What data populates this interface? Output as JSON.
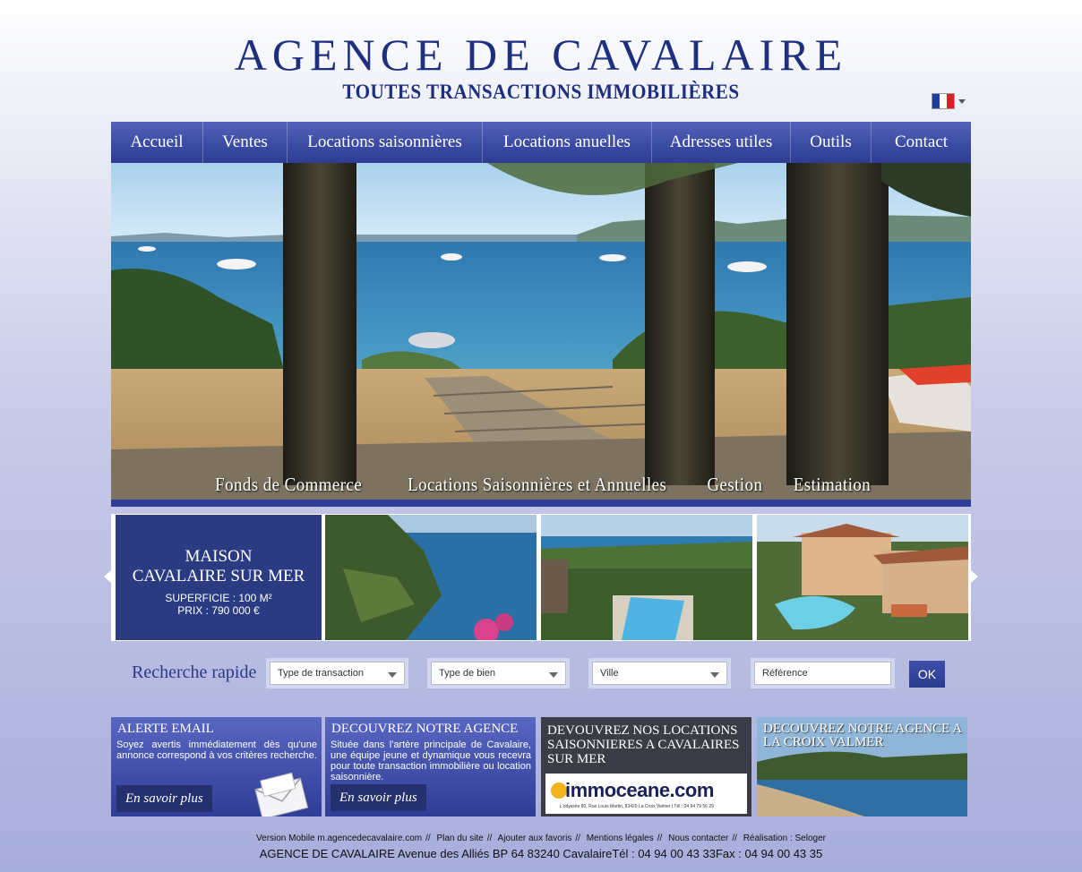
{
  "header": {
    "title": "AGENCE DE CAVALAIRE",
    "subtitle": "TOUTES TRANSACTIONS IMMOBILIÈRES",
    "language": "fr"
  },
  "nav": {
    "items": [
      {
        "label": "Accueil"
      },
      {
        "label": "Ventes"
      },
      {
        "label": "Locations saisonnières"
      },
      {
        "label": "Locations anuelles"
      },
      {
        "label": "Adresses utiles"
      },
      {
        "label": "Outils"
      },
      {
        "label": "Contact"
      }
    ]
  },
  "hero": {
    "captions": [
      "Fonds de Commerce",
      "Locations Saisonnières et Annuelles",
      "Gestion",
      "Estimation"
    ]
  },
  "listing": {
    "type": "MAISON",
    "location": "CAVALAIRE SUR MER",
    "area": "SUPERFICIE : 100 M²",
    "price": "PRIX : 790 000 €"
  },
  "search": {
    "label": "Recherche rapide",
    "transaction": "Type de transaction",
    "property": "Type de bien",
    "city": "Ville",
    "reference_placeholder": "Référence",
    "ok": "OK"
  },
  "promos": {
    "alert": {
      "title": "ALERTE EMAIL",
      "text": "Soyez avertis immédiatement dès qu'une annonce correspond à vos critères recherche.",
      "button": "En savoir plus"
    },
    "agency": {
      "title": "DECOUVREZ NOTRE AGENCE",
      "text": "Située dans l'artère principale de Cavalaire, une équipe jeune et dynamique vous recevra pour toute transaction immobilière ou location saisonnière.",
      "button": "En savoir plus"
    },
    "rentals": {
      "title": "DEVOUVREZ NOS LOCATIONS SAISONNIERES A CAVALAIRES SUR MER",
      "logo": "immoceane.com",
      "address": "L'odyssée 80, Rue Louis Martin, 83420 La Croix Valmer   |   Tél : 04 94 79 56 29"
    },
    "croix": {
      "title": "DECOUVREZ NOTRE AGENCE A LA CROIX VALMER"
    }
  },
  "footer": {
    "links": [
      "Version Mobile m.agencedecavalaire.com",
      "Plan du site",
      "Ajouter aux favoris",
      "Mentions légales",
      "Nous contacter",
      "Réalisation : Seloger"
    ],
    "address": "AGENCE DE CAVALAIRE Avenue des Alliés BP 64 83240 CavalaireTél : 04 94 00 43 33Fax : 04 94 00 43 35"
  }
}
